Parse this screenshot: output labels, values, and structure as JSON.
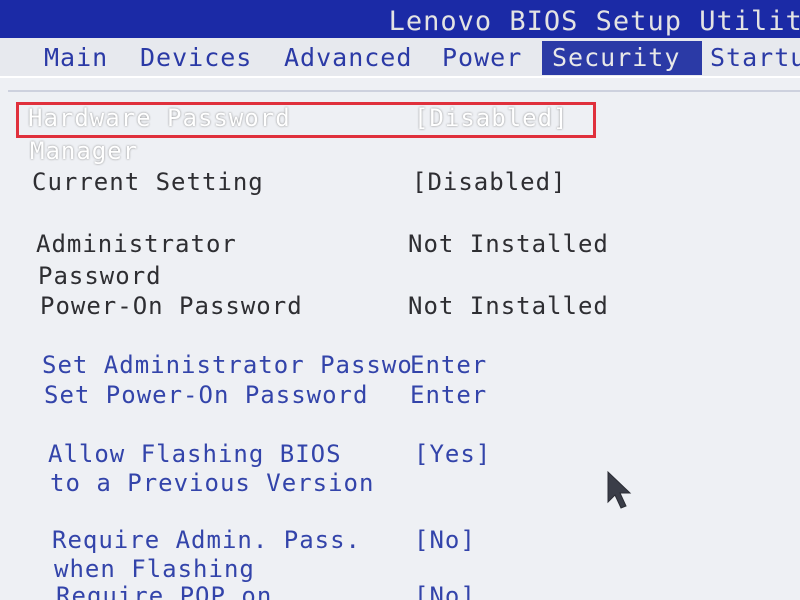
{
  "title": "Lenovo BIOS Setup Utility",
  "tabs": [
    {
      "label": "Main"
    },
    {
      "label": "Devices"
    },
    {
      "label": "Advanced"
    },
    {
      "label": "Power"
    },
    {
      "label": "Security",
      "active": true
    },
    {
      "label": "Startu"
    }
  ],
  "settings": {
    "hardware_password_manager": {
      "label_line1": "Hardware Password",
      "label_line2": "Manager",
      "value": "[Disabled]"
    },
    "current_setting": {
      "label": "Current Setting",
      "value": "[Disabled]"
    },
    "administrator_password": {
      "label_line1": "Administrator",
      "label_line2": "Password",
      "value": "Not Installed"
    },
    "power_on_password": {
      "label": "Power-On Password",
      "value": "Not Installed"
    },
    "set_administrator_password": {
      "label": "Set Administrator Passwo",
      "value": "Enter"
    },
    "set_power_on_password": {
      "label": "Set Power-On Password",
      "value": "Enter"
    },
    "allow_flashing_bios": {
      "label_line1": "Allow Flashing BIOS",
      "label_line2": "to a Previous Version",
      "value": "[Yes]"
    },
    "require_admin_pass": {
      "label_line1": "Require Admin. Pass.",
      "label_line2": "when Flashing",
      "value": "[No]"
    },
    "require_pop_on": {
      "label": "Require POP on",
      "value": "[No]"
    }
  },
  "colors": {
    "title_bar": "#1b2aa6",
    "active_tab": "#2b3aa6",
    "panel": "#eef0f4",
    "highlight_border": "#e0303c",
    "link_text": "#3344aa"
  },
  "icons": {
    "pointer": "mouse-pointer-icon"
  }
}
